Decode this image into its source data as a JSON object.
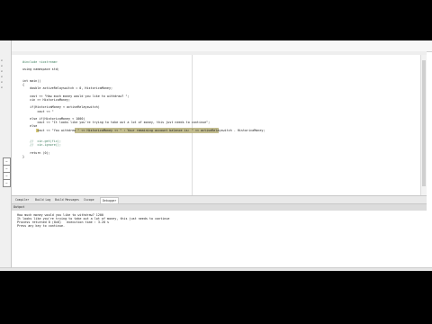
{
  "left_panel": [
    "x",
    "x",
    "x",
    "x",
    "x",
    "x"
  ],
  "editor": {
    "lines": [
      {
        "text": "#include <iostream>",
        "cls": "comment"
      },
      {
        "text": "",
        "cls": ""
      },
      {
        "text": "using namespace std;",
        "cls": ""
      },
      {
        "text": "",
        "cls": ""
      },
      {
        "text": "",
        "cls": ""
      },
      {
        "text": "int main()",
        "cls": ""
      },
      {
        "text": "{",
        "cls": ""
      },
      {
        "text": "    double activeRelayswitch = 0, HistoricaMoney;",
        "cls": ""
      },
      {
        "text": "",
        "cls": ""
      },
      {
        "text": "    cout << \"How much money would you like to withdraw? \";",
        "cls": ""
      },
      {
        "text": "    cin >> HistoricaMoney;",
        "cls": ""
      },
      {
        "text": "",
        "cls": ""
      },
      {
        "text": "    if(HistoricaMoney < activeRelayswitch)",
        "cls": ""
      },
      {
        "text": "        cout << \"",
        "cls": ""
      },
      {
        "text": "",
        "cls": ""
      },
      {
        "text": "    else if(HistoricaMoney < 1000)",
        "cls": ""
      },
      {
        "text": "        cout << \"It looks like you're trying to take out a lot of money, this just needs to continue\";",
        "cls": ""
      },
      {
        "text": "    else",
        "cls": ""
      },
      {
        "text": "        cout << \"You withdrew \" << HistoricaMoney << \" : Your remaining account balance is: \" << activeRelayswitch - HistoricaMoney;",
        "cls": ""
      },
      {
        "text": "",
        "cls": ""
      },
      {
        "text": "",
        "cls": ""
      },
      {
        "text": "    //  cin.get(fic);",
        "cls": "comment"
      },
      {
        "text": "    //  cin.ignore();",
        "cls": "comment"
      },
      {
        "text": "",
        "cls": ""
      },
      {
        "text": "    return (0);",
        "cls": ""
      },
      {
        "text": "}",
        "cls": ""
      }
    ]
  },
  "tabs": [
    {
      "label": "Compiler",
      "active": false
    },
    {
      "label": "Build Log",
      "active": false
    },
    {
      "label": "Build Messages",
      "active": false
    },
    {
      "label": "Cscope",
      "active": false
    },
    {
      "label": "Debugger",
      "active": true
    }
  ],
  "output": {
    "title": "Output",
    "lines": [
      "How much money would you like to withdraw? 1200",
      "It looks like you're trying to take out a lot of money, this just needs to continue",
      "Process returned 0 (0x0)   execution time : 3.20 s",
      "Press any key to continue."
    ]
  }
}
